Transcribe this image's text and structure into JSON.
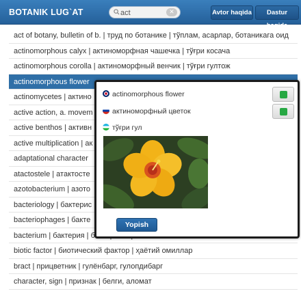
{
  "header": {
    "title": "BOTANIK LUG`AT",
    "search": {
      "value": "act",
      "placeholder": "Q"
    },
    "clear_icon": "x-icon",
    "about_label": "Avtor haqida",
    "guide_label": "Dastur haqida"
  },
  "entries": [
    "act of botany, bulletin of b. | труд по ботанике | тўплам, асарлар, ботаникага оид",
    "actinomorphous calyx | актиноморфная чашечка | тўғри косача",
    "actinomorphous corolla | актиноморфный венчик | тўғри гултож",
    "actinomorphous flower",
    "actinomycetes | актино",
    "active action, a. movem",
    "active benthos | активн",
    "active multiplication | ак",
    "adaptational character",
    "atactostele | атактосте",
    "azotobacterium | азото",
    "bacteriology | бактерис",
    "bacteriophages | бакте",
    "bacterium | бактерия | бактериялар",
    "biotic factor | биотический фактор | ҳаётий омиллар",
    "bract | прицветник | гулёнбарг, гулопдибарг",
    "character, sign | признак | белги, аломат"
  ],
  "selected_index": 3,
  "popup": {
    "english": "actinomorphous flower",
    "russian": "актиноморфный цветок",
    "uzbek": "тўғри гул",
    "close_label": "Yopish",
    "sound_icon": "speaker-icon",
    "colors": {
      "accent": "#2f6fa7",
      "sound": "#27a843",
      "petal": "#f2b318"
    }
  }
}
